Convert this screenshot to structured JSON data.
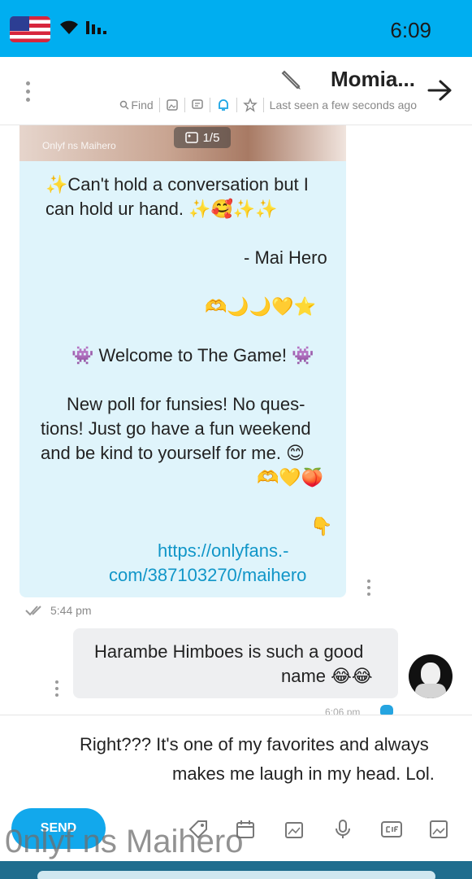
{
  "status_bar": {
    "time": "6:09",
    "icons": [
      "flag-icon",
      "wifi-icon",
      "signal-icon"
    ],
    "background": "#00aef0"
  },
  "header": {
    "title": "Momia...",
    "last_seen": "Last seen a few seconds ago",
    "find_label": "Find",
    "icons": [
      "back-arrow-icon",
      "edit-icon",
      "star-icon",
      "bell-icon",
      "message-icon",
      "image-icon",
      "search-icon",
      "more-icon"
    ]
  },
  "photo_preview": {
    "counter": "1/5",
    "watermark": "Onlyf ns Maihero"
  },
  "incoming_message": {
    "line1": "✨Can't hold a conversation but I",
    "line2": "can hold ur hand. ✨🥰✨✨",
    "line3": "- Mai Hero",
    "line4": "🫶🌙🌙💛⭐",
    "line5": "👾 Welcome to The Game! 👾",
    "line6": "New poll for funsies! No ques-",
    "line7": "tions! Just go have a fun weekend",
    "line8": "and be kind to yourself for me. 😊",
    "line9": "🫶💛🍑",
    "line10": "👇",
    "link1": "https://onlyfans.-",
    "link2": "com/387103270/maihero",
    "time": "5:44 pm",
    "accent": "#dff4fb"
  },
  "outgoing_message": {
    "line1": "Harambe Himboes is such a good",
    "line2": "name 😂😂",
    "time": "6:06 pm"
  },
  "composer": {
    "text_line1": "Right??? It's one of my favorites and always",
    "text_line2": "makes me laugh in my head. Lol.",
    "send_label": "SEND",
    "tools": [
      "image-icon",
      "gif-icon",
      "mic-icon",
      "vault-icon",
      "calendar-icon",
      "tag-icon"
    ]
  },
  "watermark": "0nlyf ns Maihero"
}
